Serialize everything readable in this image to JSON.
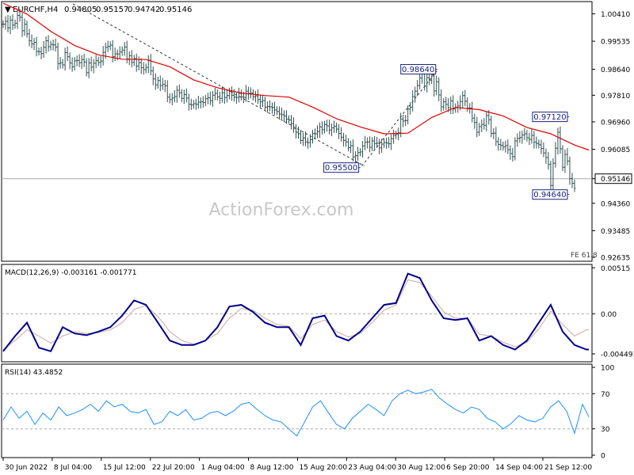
{
  "chart_data": {
    "type": "line",
    "header": {
      "symbol": "EURCHF,H4",
      "ohlc": [
        "0.94805",
        "0.95157",
        "0.94742",
        "0.95146"
      ]
    },
    "watermark": "ActionForex.com",
    "x_labels": [
      "30 Jun 2022",
      "8 Jul 04:00",
      "15 Jul 12:00",
      "22 Jul 20:00",
      "1 Aug 04:00",
      "8 Aug 12:00",
      "15 Aug 20:00",
      "23 Aug 04:00",
      "30 Aug 12:00",
      "6 Sep 20:00",
      "14 Sep 04:00",
      "21 Sep 12:00"
    ],
    "price": {
      "ylim": [
        0.9256,
        1.0075
      ],
      "y_ticks": [
        "1.00410",
        "0.99535",
        "0.98640",
        "0.97810",
        "0.96960",
        "0.96085",
        "0.95146",
        "0.94360",
        "0.93485",
        "0.92635"
      ],
      "current_price": "0.95146",
      "fe_label": "FE 61.8",
      "series": [
        {
          "name": "EURCHF H4",
          "type": "bar",
          "x": [
            0,
            3,
            6,
            9,
            12,
            15,
            18,
            21,
            24,
            27,
            30,
            33,
            36,
            39,
            42,
            45,
            48,
            51,
            54,
            57,
            60,
            63,
            66,
            69,
            72,
            75,
            78,
            81,
            84,
            87,
            90,
            93,
            96,
            99,
            102,
            105,
            108,
            111,
            114,
            117,
            120,
            123,
            126,
            129,
            132,
            135,
            138,
            141,
            144,
            147,
            150,
            153,
            156,
            159,
            162,
            165,
            168,
            171,
            174,
            177,
            180,
            183,
            186,
            189,
            192,
            195,
            198,
            201,
            204,
            207,
            210,
            213,
            216,
            219,
            222,
            225,
            228,
            231,
            234,
            237,
            240,
            243,
            246,
            249,
            252,
            255,
            258,
            261,
            264,
            267,
            270,
            273,
            276,
            279,
            282,
            285,
            288,
            291,
            294,
            297,
            300,
            303,
            306,
            309,
            312,
            315,
            318,
            321,
            324,
            327,
            330,
            333,
            336,
            339,
            342,
            345,
            348,
            351,
            354,
            357,
            360,
            363,
            366,
            369,
            372,
            375,
            378,
            381,
            384,
            387,
            390,
            393,
            396,
            399,
            402,
            405,
            408,
            411,
            414,
            417,
            420,
            423,
            426,
            429,
            432,
            435,
            438,
            441,
            444,
            447,
            450,
            453,
            456,
            459,
            462,
            465,
            468,
            471,
            474,
            477,
            480,
            483,
            486,
            489,
            492,
            495,
            498,
            501,
            504,
            507,
            510,
            513,
            516,
            519,
            522,
            525,
            528,
            531,
            534,
            537,
            540,
            543,
            546,
            549,
            552,
            555,
            558,
            561,
            564,
            567,
            570,
            573,
            576,
            579,
            582,
            585,
            588,
            591,
            594,
            597,
            600,
            603,
            606,
            609,
            612,
            615,
            618,
            621,
            624,
            627,
            630,
            633,
            636,
            639,
            642,
            645,
            648,
            651,
            654,
            657,
            660,
            663,
            666,
            669,
            672,
            675,
            678,
            681,
            684,
            687,
            690,
            693,
            696,
            699,
            702,
            705,
            708,
            711,
            714,
            717,
            720,
            723,
            726,
            729,
            732,
            735,
            738
          ],
          "values": [
            1.0008,
            1.0017,
            0.9996,
            1.0021,
            1.0005,
            1.0011,
            1.0036,
            1.003,
            0.9987,
            1.0008,
            0.9977,
            0.9955,
            0.9945,
            0.995,
            0.9921,
            0.992,
            0.9914,
            0.9934,
            0.9955,
            0.9936,
            0.9943,
            0.9942,
            0.9935,
            0.9882,
            0.9885,
            0.9878,
            0.9917,
            0.9904,
            0.9884,
            0.9872,
            0.9891,
            0.9892,
            0.9885,
            0.9895,
            0.9887,
            0.9853,
            0.9884,
            0.9871,
            0.9883,
            0.9892,
            0.9886,
            0.989,
            0.9918,
            0.9934,
            0.9937,
            0.9941,
            0.9904,
            0.9913,
            0.9913,
            0.9919,
            0.9925,
            0.9935,
            0.9897,
            0.9907,
            0.9886,
            0.9898,
            0.9874,
            0.9885,
            0.9869,
            0.9863,
            0.987,
            0.9893,
            0.9859,
            0.9833,
            0.9814,
            0.9828,
            0.9812,
            0.9816,
            0.9811,
            0.9775,
            0.9767,
            0.9772,
            0.9777,
            0.9797,
            0.9789,
            0.9771,
            0.9783,
            0.9772,
            0.9752,
            0.975,
            0.9754,
            0.9752,
            0.9759,
            0.976,
            0.9758,
            0.977,
            0.9773,
            0.9764,
            0.9781,
            0.9787,
            0.9776,
            0.9771,
            0.9789,
            0.9774,
            0.978,
            0.9793,
            0.9781,
            0.9775,
            0.9774,
            0.9787,
            0.9776,
            0.9774,
            0.9794,
            0.9787,
            0.9788,
            0.9776,
            0.9779,
            0.9767,
            0.976,
            0.9764,
            0.9743,
            0.9745,
            0.9744,
            0.9742,
            0.9734,
            0.9729,
            0.9721,
            0.9719,
            0.9715,
            0.9705,
            0.9702,
            0.969,
            0.9675,
            0.9663,
            0.9658,
            0.9637,
            0.9645,
            0.9632,
            0.963,
            0.9639,
            0.9659,
            0.9658,
            0.9665,
            0.968,
            0.9671,
            0.9687,
            0.9683,
            0.967,
            0.9677,
            0.9682,
            0.9673,
            0.9659,
            0.9647,
            0.9637,
            0.9632,
            0.9614,
            0.962,
            0.9584,
            0.9588,
            0.9598,
            0.96,
            0.9619,
            0.9631,
            0.9632,
            0.9615,
            0.9635,
            0.9627,
            0.9628,
            0.9613,
            0.9625,
            0.963,
            0.9628,
            0.9626,
            0.9642,
            0.9653,
            0.9656,
            0.9661,
            0.9705,
            0.9699,
            0.97,
            0.9737,
            0.9743,
            0.9777,
            0.9794,
            0.9812,
            0.9836,
            0.9853,
            0.981,
            0.9837,
            0.9829,
            0.9847,
            0.9795,
            0.9824,
            0.9782,
            0.9744,
            0.976,
            0.9752,
            0.9741,
            0.9763,
            0.9737,
            0.9743,
            0.9747,
            0.9761,
            0.978,
            0.9762,
            0.974,
            0.974,
            0.9708,
            0.9694,
            0.9663,
            0.9681,
            0.9688,
            0.9685,
            0.9716,
            0.9703,
            0.9659,
            0.966,
            0.9633,
            0.9624,
            0.9621,
            0.9616,
            0.962,
            0.9607,
            0.9595,
            0.9585,
            0.9635,
            0.9643,
            0.9646,
            0.9654,
            0.9658,
            0.9645,
            0.964,
            0.9653,
            0.9631,
            0.9627,
            0.9623,
            0.9611,
            0.9597,
            0.9582,
            0.956,
            0.9493,
            0.9564,
            0.9612,
            0.9663,
            0.961,
            0.9551,
            0.9592,
            0.9571,
            0.9515,
            0.95,
            0.9484
          ]
        },
        {
          "name": "Moving average",
          "type": "line",
          "x": [
            0,
            30,
            60,
            90,
            120,
            150,
            180,
            210,
            240,
            270,
            300,
            330,
            360,
            390,
            420,
            450,
            480,
            510,
            540,
            570,
            600,
            630,
            660,
            690,
            720,
            738
          ],
          "values": [
            1.0075,
            1.004,
            0.9985,
            0.994,
            0.991,
            0.9896,
            0.9895,
            0.9872,
            0.983,
            0.9805,
            0.9788,
            0.978,
            0.9775,
            0.9743,
            0.9706,
            0.968,
            0.9658,
            0.966,
            0.971,
            0.9742,
            0.9735,
            0.9715,
            0.9678,
            0.9658,
            0.9622,
            0.9606
          ]
        }
      ],
      "annotations": [
        {
          "text": "0.95500",
          "x": 450,
          "y": 0.955
        },
        {
          "text": "0.98640",
          "x": 547,
          "y": 0.9864
        },
        {
          "text": "0.97120",
          "x": 713,
          "y": 0.9712
        },
        {
          "text": "0.94640",
          "x": 713,
          "y": 0.9464
        }
      ],
      "trendlines": [
        {
          "x": [
            88,
            455
          ],
          "y": [
            1.0073,
            0.9555
          ]
        },
        {
          "x": [
            452,
            548
          ],
          "y": [
            0.9555,
            0.9864
          ]
        }
      ]
    },
    "macd": {
      "label": "MACD(12,26,9) -0.003161 -0.001771",
      "ylim": [
        -0.0052,
        0.00535
      ],
      "y_ticks": [
        "0.00515",
        "0.00",
        "-0.004493"
      ],
      "x": [
        0,
        15,
        30,
        45,
        60,
        75,
        90,
        105,
        120,
        135,
        150,
        165,
        180,
        195,
        210,
        225,
        240,
        255,
        270,
        285,
        300,
        315,
        330,
        345,
        360,
        375,
        390,
        405,
        420,
        435,
        450,
        465,
        480,
        495,
        510,
        525,
        540,
        555,
        570,
        585,
        600,
        615,
        630,
        645,
        660,
        675,
        690,
        705,
        720,
        735,
        738
      ],
      "macd": [
        -0.0042,
        -0.0025,
        -0.001,
        -0.0038,
        -0.0042,
        -0.0015,
        -0.0022,
        -0.0024,
        -0.002,
        -0.0015,
        -0.0002,
        0.0015,
        0.001,
        -0.001,
        -0.003,
        -0.0035,
        -0.0035,
        -0.003,
        -0.0015,
        0.0008,
        0.001,
        0.0002,
        -0.001,
        -0.0015,
        -0.0015,
        -0.0035,
        -0.0005,
        -0.0002,
        -0.0025,
        -0.003,
        -0.002,
        -0.0005,
        0.001,
        0.0012,
        0.0045,
        0.004,
        0.0015,
        -0.0005,
        -0.0007,
        -0.0005,
        -0.003,
        -0.0025,
        -0.0035,
        -0.004,
        -0.003,
        -0.001,
        0.001,
        -0.002,
        -0.0035,
        -0.004,
        -0.004
      ],
      "signal": [
        -0.004,
        -0.003,
        -0.0018,
        -0.0025,
        -0.0033,
        -0.0025,
        -0.002,
        -0.0022,
        -0.0021,
        -0.0018,
        -0.001,
        0.0005,
        0.0009,
        -0.0003,
        -0.002,
        -0.003,
        -0.0034,
        -0.003,
        -0.0022,
        -0.0005,
        0.0006,
        0.0004,
        -0.0005,
        -0.0012,
        -0.0014,
        -0.0028,
        -0.0012,
        -0.0007,
        -0.002,
        -0.0026,
        -0.0022,
        -0.001,
        0.0004,
        0.001,
        0.0038,
        0.0035,
        0.002,
        0.0002,
        -0.0005,
        -0.0005,
        -0.0023,
        -0.0025,
        -0.0032,
        -0.0037,
        -0.0032,
        -0.0017,
        0.0003,
        -0.0012,
        -0.0025,
        -0.0018,
        -0.0018
      ]
    },
    "rsi": {
      "label": "RSI(14) 43.4852",
      "ylim": [
        0,
        100
      ],
      "y_ticks": [
        "100",
        "70",
        "30",
        "0"
      ],
      "levels": [
        70,
        30
      ],
      "x": [
        0,
        10,
        20,
        30,
        40,
        50,
        60,
        70,
        80,
        90,
        100,
        110,
        120,
        130,
        140,
        150,
        160,
        170,
        180,
        190,
        200,
        210,
        220,
        230,
        240,
        250,
        260,
        270,
        280,
        290,
        300,
        310,
        320,
        330,
        340,
        350,
        360,
        370,
        380,
        390,
        400,
        410,
        420,
        430,
        440,
        450,
        460,
        470,
        480,
        490,
        500,
        510,
        520,
        530,
        540,
        550,
        560,
        570,
        580,
        590,
        600,
        610,
        620,
        630,
        640,
        650,
        660,
        670,
        680,
        690,
        700,
        710,
        720,
        730,
        738
      ],
      "values": [
        40,
        55,
        42,
        50,
        35,
        48,
        40,
        55,
        45,
        48,
        52,
        58,
        50,
        62,
        55,
        58,
        50,
        48,
        52,
        35,
        38,
        50,
        45,
        52,
        40,
        42,
        48,
        50,
        45,
        50,
        58,
        60,
        52,
        45,
        40,
        38,
        30,
        22,
        38,
        55,
        62,
        48,
        35,
        30,
        42,
        50,
        58,
        52,
        45,
        62,
        70,
        74,
        70,
        72,
        75,
        65,
        58,
        52,
        48,
        55,
        52,
        42,
        38,
        30,
        36,
        45,
        40,
        38,
        42,
        55,
        62,
        50,
        25,
        58,
        43.49
      ]
    }
  }
}
